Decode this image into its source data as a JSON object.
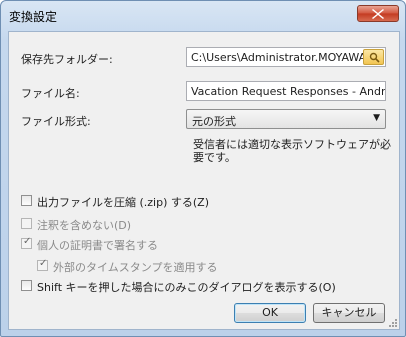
{
  "window": {
    "title": "変換設定",
    "close_icon": "close-icon"
  },
  "form": {
    "folder_label": "保存先フォルダー:",
    "folder_value": "C:\\Users\\Administrator.MOYAWARE",
    "filename_label": "ファイル名:",
    "filename_value": "Vacation Request Responses - Andrew J.",
    "format_label": "ファイル形式:",
    "format_value": "元の形式",
    "format_note": "受信者には適切な表示ソフトウェアが必要です。"
  },
  "options": {
    "zip": {
      "label": "出力ファイルを圧縮 (.zip) する(Z)",
      "checked": false,
      "enabled": true
    },
    "no_annotations": {
      "label": "注釈を含めない(D)",
      "checked": false,
      "enabled": false
    },
    "sign": {
      "label": "個人の証明書で署名する",
      "checked": true,
      "enabled": false
    },
    "timestamp": {
      "label": "外部のタイムスタンプを適用する",
      "checked": true,
      "enabled": false
    },
    "shift_dialog": {
      "label": "Shift キーを押した場合にのみこのダイアログを表示する(O)",
      "checked": false,
      "enabled": true
    }
  },
  "buttons": {
    "ok": "OK",
    "cancel": "キャンセル"
  }
}
